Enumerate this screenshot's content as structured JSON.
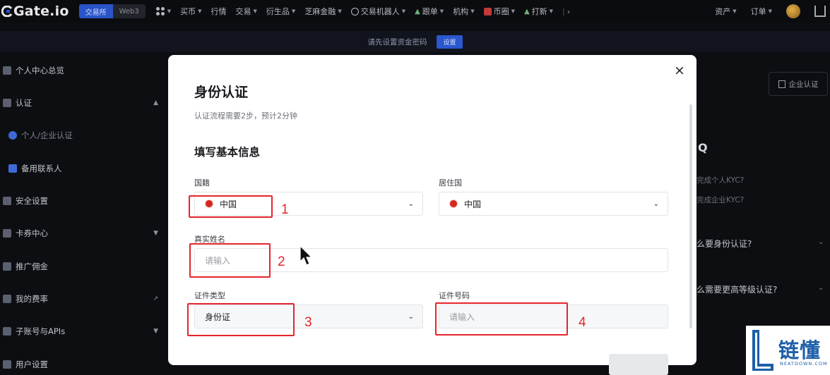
{
  "topbar": {
    "logo": "Gate.io",
    "mode_tabs": [
      "交易所",
      "Web3"
    ],
    "nav_items": [
      "买币",
      "行情",
      "交易",
      "衍生品",
      "芝麻金融",
      "交易机器人",
      "跟单",
      "机构",
      "币圈",
      "打新"
    ],
    "right_items": [
      "资产",
      "订单"
    ]
  },
  "notice": {
    "text": "请先设置资金密码",
    "button": "设置"
  },
  "sidebar": {
    "items": [
      {
        "label": "个人中心总览"
      },
      {
        "label": "认证"
      },
      {
        "label": "个人/企业认证"
      },
      {
        "label": "备用联系人"
      },
      {
        "label": "安全设置"
      },
      {
        "label": "卡券中心"
      },
      {
        "label": "推广佣金"
      },
      {
        "label": "我的费率"
      },
      {
        "label": "子账号与APIs"
      },
      {
        "label": "用户设置"
      }
    ]
  },
  "right_panel": {
    "biz_button": "企业认证",
    "faq_title": "Q",
    "faq_lines": [
      "完成个人KYC?",
      "完成企业KYC?"
    ],
    "faq_questions": [
      "么要身份认证?",
      "么需要更高等级认证?"
    ]
  },
  "modal": {
    "title": "身份认证",
    "subtitle": "认证流程需要2步，预计2分钟",
    "section_title": "填写基本信息",
    "close_icon": "×",
    "fields": {
      "nationality": {
        "label": "国籍",
        "value": "中国"
      },
      "residence": {
        "label": "居住国",
        "value": "中国"
      },
      "real_name": {
        "label": "真实姓名",
        "placeholder": "请输入"
      },
      "id_type": {
        "label": "证件类型",
        "value": "身份证"
      },
      "id_number": {
        "label": "证件号码",
        "placeholder": "请输入"
      }
    },
    "annotations": [
      "1",
      "2",
      "3",
      "4"
    ],
    "annotation_color": "#e5252c"
  },
  "watermark": {
    "brand": "链懂",
    "site": "NEATDOWN.COM"
  }
}
